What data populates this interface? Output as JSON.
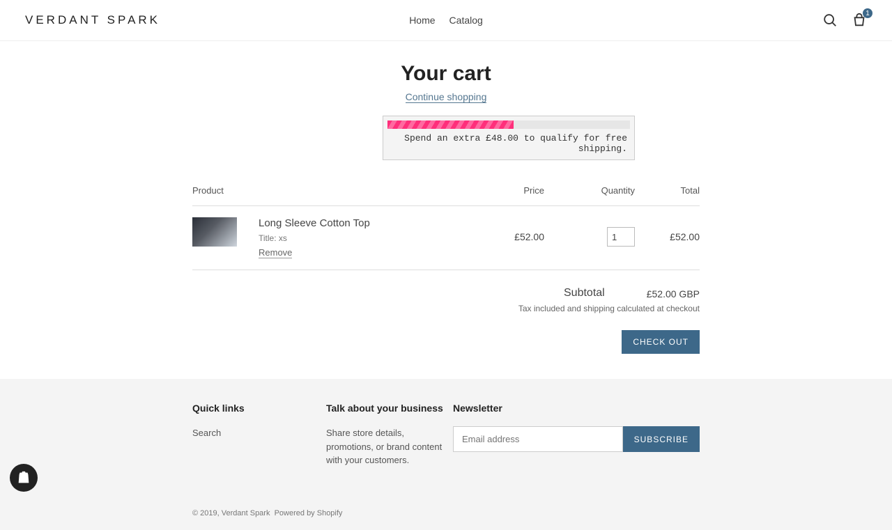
{
  "header": {
    "logo": "VERDANT SPARK",
    "nav": {
      "home": "Home",
      "catalog": "Catalog"
    },
    "cart_count": "1"
  },
  "page": {
    "title": "Your cart",
    "continue": "Continue shopping"
  },
  "free_shipping": {
    "message": "Spend an extra £48.00 to qualify for free shipping."
  },
  "table": {
    "product": "Product",
    "price": "Price",
    "quantity": "Quantity",
    "total": "Total"
  },
  "items": [
    {
      "name": "Long Sleeve Cotton Top",
      "variant": "Title: xs",
      "remove": "Remove",
      "price": "£52.00",
      "qty": "1",
      "total": "£52.00"
    }
  ],
  "summary": {
    "subtotal_label": "Subtotal",
    "subtotal_value": "£52.00 GBP",
    "tax_note": "Tax included and shipping calculated at checkout",
    "checkout": "CHECK OUT"
  },
  "footer": {
    "quicklinks_title": "Quick links",
    "search": "Search",
    "about_title": "Talk about your business",
    "about_text": "Share store details, promotions, or brand content with your customers.",
    "newsletter_title": "Newsletter",
    "email_placeholder": "Email address",
    "subscribe": "SUBSCRIBE",
    "copyright_prefix": "© 2019, ",
    "store_name": "Verdant Spark",
    "powered": "Powered by Shopify"
  }
}
